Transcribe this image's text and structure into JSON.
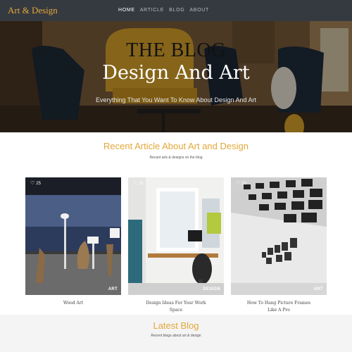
{
  "nav": {
    "brand": "Art & Design",
    "links": [
      {
        "label": "HOME",
        "active": true
      },
      {
        "label": "ARTICLE",
        "active": false
      },
      {
        "label": "BLOG",
        "active": false
      },
      {
        "label": "ABOUT",
        "active": false
      }
    ]
  },
  "hero": {
    "kicker": "THE BLOG",
    "title": "Design And Art",
    "subtitle": "Everything That You Want To Know About Design And Art"
  },
  "recent": {
    "title": "Recent Article About Art and Design",
    "subtitle": "Recant arts & designs on the blog"
  },
  "articles": [
    {
      "likes": "25",
      "category": "ART",
      "title": "Wood Art"
    },
    {
      "likes": "22",
      "category": "DESIGN",
      "title": "Design Ideas For Your Work Space"
    },
    {
      "likes": "22",
      "category": "ART",
      "title": "How To Hang Picture Frames Like A Pro"
    }
  ],
  "latest": {
    "title": "Latest Blog",
    "subtitle": "Recent blogs about art & design"
  },
  "colors": {
    "accent": "#e3a73b",
    "navbar": "#353a40"
  },
  "icons": [
    "heart-icon"
  ]
}
